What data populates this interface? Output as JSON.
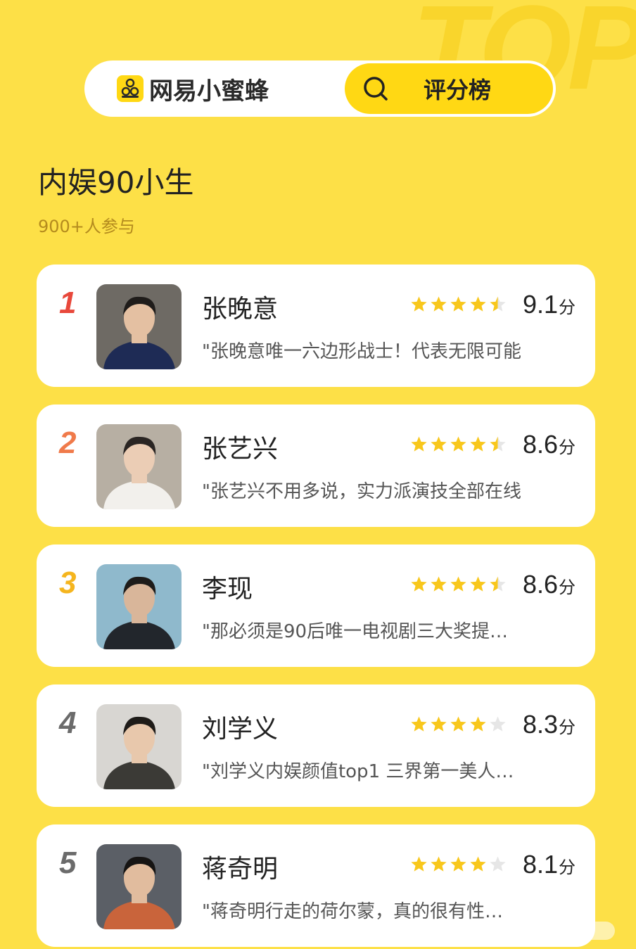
{
  "background_word": "TOP",
  "header": {
    "brand_name": "网易小蜜蜂",
    "search_label": "评分榜"
  },
  "title": "内娱90小生",
  "subtitle": "900+人参与",
  "unit": "分",
  "colors": {
    "background": "#FDE047",
    "accent": "#FFD814",
    "star": "#F8C71C",
    "rank_1": "#E8483B",
    "rank_2": "#F07A4A",
    "rank_3": "#F5B51E",
    "rank_other": "#6B6B6B"
  },
  "items": [
    {
      "rank": "1",
      "name": "张晚意",
      "rating_stars": 4.5,
      "score": "9.1",
      "quote": "\"张晚意唯一六边形战士！代表无限可能"
    },
    {
      "rank": "2",
      "name": "张艺兴",
      "rating_stars": 4.5,
      "score": "8.6",
      "quote": "\"张艺兴不用多说，实力派演技全部在线"
    },
    {
      "rank": "3",
      "name": "李现",
      "rating_stars": 4.5,
      "score": "8.6",
      "quote": "\"那必须是90后唯一电视剧三大奖提…"
    },
    {
      "rank": "4",
      "name": "刘学义",
      "rating_stars": 4,
      "score": "8.3",
      "quote": "\"刘学义内娱颜值top1 三界第一美人…"
    },
    {
      "rank": "5",
      "name": "蒋奇明",
      "rating_stars": 4,
      "score": "8.1",
      "quote": "\"蒋奇明行走的荷尔蒙，真的很有性…"
    }
  ]
}
